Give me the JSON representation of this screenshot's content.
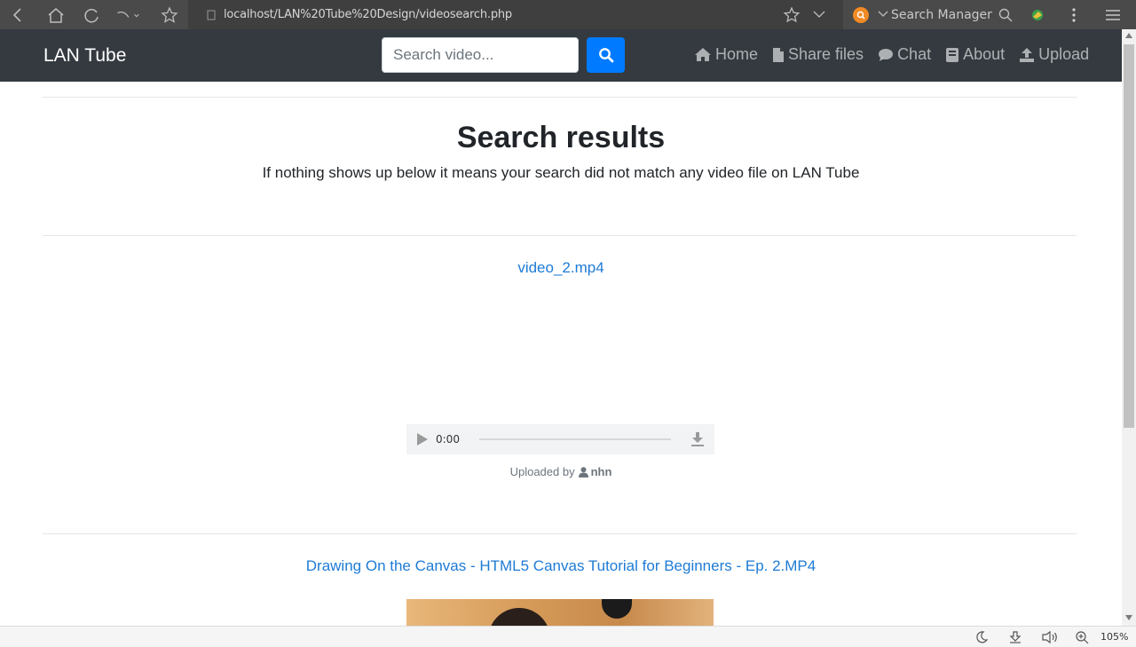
{
  "browser": {
    "url": "localhost/LAN%20Tube%20Design/videosearch.php",
    "search_manager_label": "Search Manager",
    "zoom": "105%"
  },
  "navbar": {
    "brand": "LAN Tube",
    "search_placeholder": "Search video...",
    "links": [
      {
        "label": "Home",
        "icon": "home-icon"
      },
      {
        "label": "Share files",
        "icon": "file-icon"
      },
      {
        "label": "Chat",
        "icon": "comment-icon"
      },
      {
        "label": "About",
        "icon": "book-icon"
      },
      {
        "label": "Upload",
        "icon": "upload-icon"
      }
    ]
  },
  "main": {
    "title": "Search results",
    "subtitle": "If nothing shows up below it means your search did not match any video file on LAN Tube"
  },
  "results": [
    {
      "filename": "video_2.mp4",
      "player_time": "0:00",
      "uploaded_prefix": "Uploaded by",
      "uploader": "nhn"
    },
    {
      "filename": "Drawing On the Canvas - HTML5 Canvas Tutorial for Beginners - Ep. 2.MP4"
    }
  ],
  "colors": {
    "navbar_bg": "#343a40",
    "primary": "#007bff",
    "link": "#1e7bd6"
  }
}
